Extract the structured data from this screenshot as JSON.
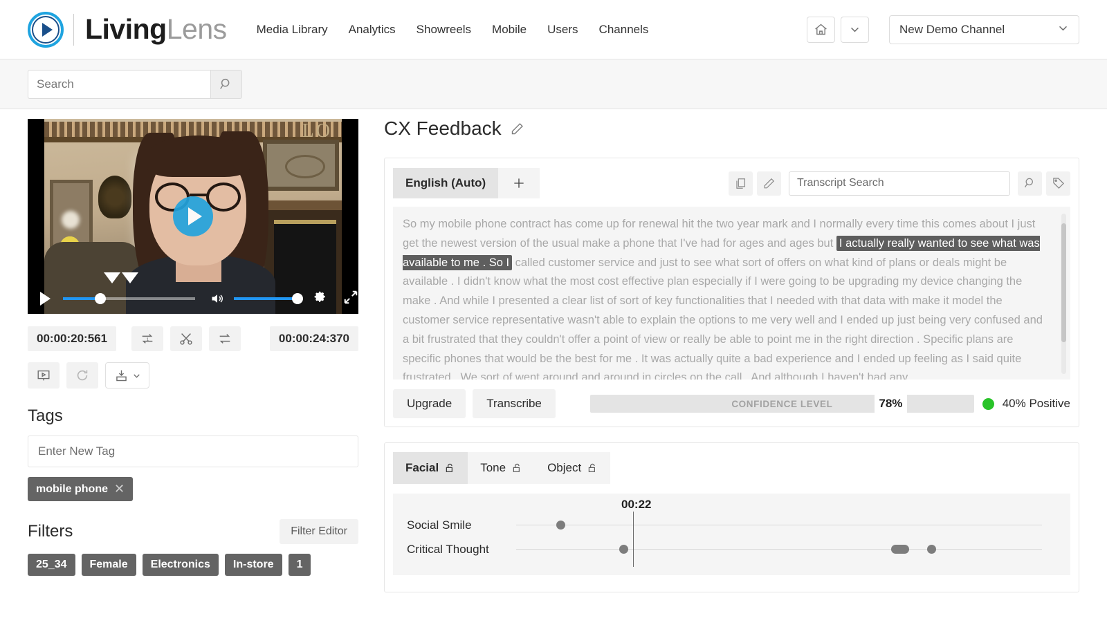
{
  "header": {
    "brand_bold": "Living",
    "brand_light": "Lens",
    "nav": [
      {
        "label": "Media Library"
      },
      {
        "label": "Analytics"
      },
      {
        "label": "Showreels"
      },
      {
        "label": "Mobile"
      },
      {
        "label": "Users"
      },
      {
        "label": "Channels"
      }
    ],
    "home_icon": "home-icon",
    "home_chevron_icon": "chevron-down-icon",
    "channel_value": "New Demo Channel",
    "channel_chevron_icon": "chevron-down-icon"
  },
  "search": {
    "placeholder": "Search",
    "value": "",
    "button_icon": "search-icon"
  },
  "player": {
    "play_overlay_icon": "play-icon",
    "play_button_icon": "play-icon",
    "volume_icon": "volume-icon",
    "settings_icon": "gear-icon",
    "fullscreen_icon": "expand-icon",
    "start_timecode": "00:00:20:561",
    "end_timecode": "00:00:24:370",
    "tools": [
      {
        "name": "repeat-one-icon"
      },
      {
        "name": "scissors-icon"
      },
      {
        "name": "repeat-icon"
      }
    ],
    "actions": [
      {
        "name": "showreel-icon"
      },
      {
        "name": "refresh-icon"
      },
      {
        "name": "download-icon",
        "chevron": "chevron-down-icon"
      }
    ]
  },
  "tags": {
    "title": "Tags",
    "input_placeholder": "Enter New Tag",
    "input_value": "",
    "items": [
      {
        "label": "mobile phone",
        "remove_icon": "close-icon"
      }
    ]
  },
  "filters": {
    "title": "Filters",
    "editor_label": "Filter Editor",
    "items": [
      "25_34",
      "Female",
      "Electronics",
      "In-store",
      "1"
    ]
  },
  "main": {
    "title": "CX Feedback",
    "title_edit_icon": "pencil-icon"
  },
  "transcript": {
    "language_tab": "English (Auto)",
    "add_language_icon": "plus-icon",
    "copy_icon": "copy-icon",
    "edit_icon": "pencil-icon",
    "search_placeholder": "Transcript Search",
    "search_value": "",
    "search_icon": "search-icon",
    "tag_icon": "tag-icon",
    "segments": [
      {
        "text": "So my mobile phone contract has come up for renewal hit the two year mark and I normally every time this comes about I just get the newest version of the usual make a phone that I've had for ages and ages but ",
        "highlight": false
      },
      {
        "text": "I actually really wanted to see what was available to me . So I",
        "highlight": true
      },
      {
        "text": " called customer service and just to see what sort of offers on what kind of plans or deals might be available . I didn't know what the most cost effective plan especially if I were going to be upgrading my device changing the make . And while I presented a clear list of sort of key functionalities that I needed with that data with make it model the customer service representative wasn't able to explain the options to me very well and I ended up just being very confused and a bit frustrated that they couldn't offer a point of view or really be able to point me in the right direction . Specific plans are specific phones that would be the best for me . It was actually quite a bad experience and I ended up feeling as I said quite frustrated . We sort of went around and around in circles on the call . And although I haven't had any",
        "highlight": false
      }
    ],
    "upgrade_label": "Upgrade",
    "transcribe_label": "Transcribe",
    "confidence_label": "CONFIDENCE LEVEL",
    "confidence_value": "78%",
    "sentiment_label": "40% Positive",
    "sentiment_color": "#28c328"
  },
  "analysis": {
    "tabs": [
      {
        "label": "Facial",
        "lock_icon": "unlock-icon",
        "active": true
      },
      {
        "label": "Tone",
        "lock_icon": "unlock-icon",
        "active": false
      },
      {
        "label": "Object",
        "lock_icon": "unlock-icon",
        "active": false
      }
    ],
    "chart_data": {
      "type": "scatter",
      "title": "",
      "playhead_time": "00:22",
      "categories": [
        "Social Smile",
        "Critical Thought"
      ],
      "series": [
        {
          "name": "Social Smile",
          "points": [
            {
              "x": 0.085,
              "w": 13
            }
          ]
        },
        {
          "name": "Critical Thought",
          "points": [
            {
              "x": 0.205,
              "w": 13
            },
            {
              "x": 0.735,
              "w": 26
            },
            {
              "x": 0.823,
              "w": 13
            }
          ]
        }
      ],
      "xlim": [
        0,
        1
      ],
      "playhead_x": 0.228,
      "grid": false,
      "legend": "none"
    }
  }
}
